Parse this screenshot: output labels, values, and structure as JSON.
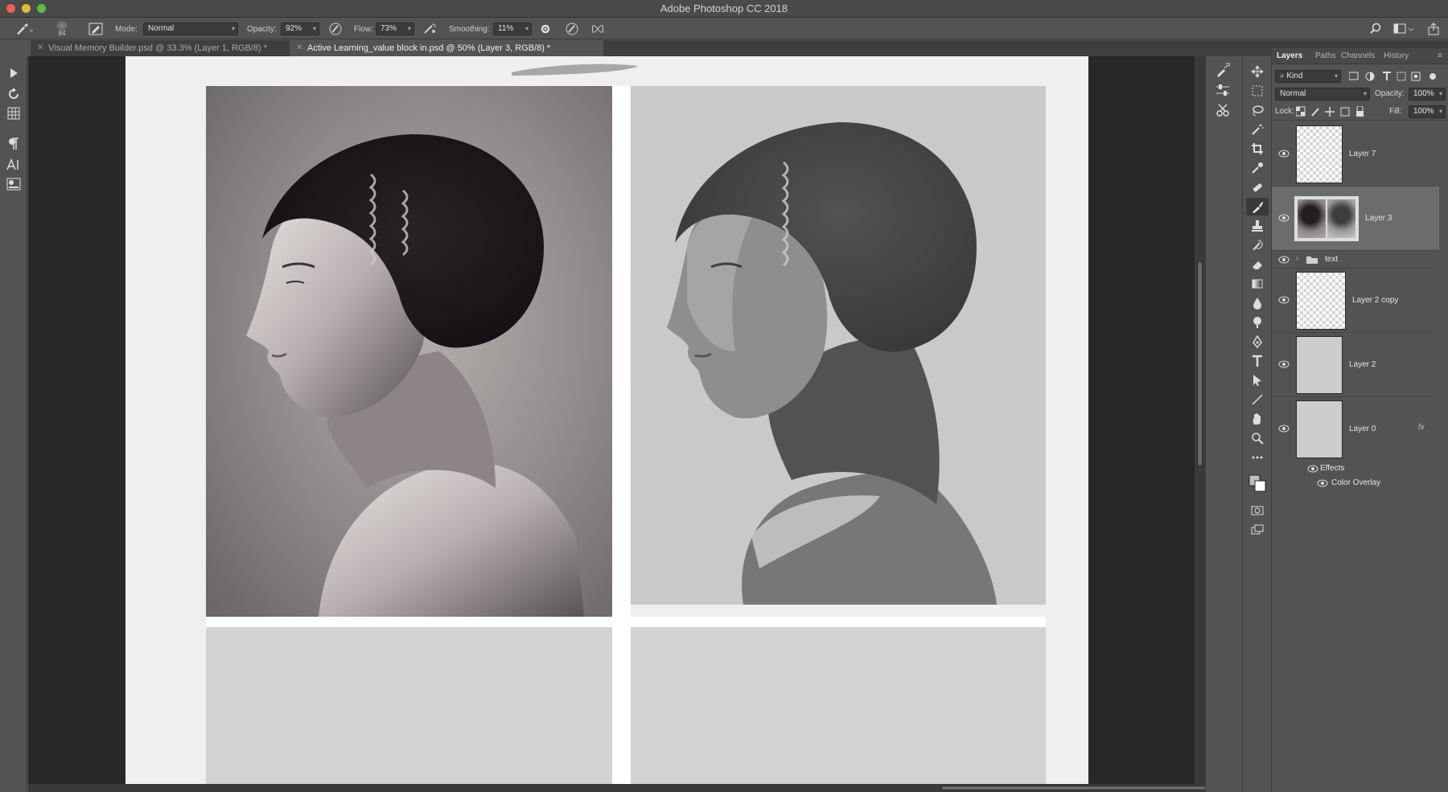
{
  "window": {
    "title": "Adobe Photoshop CC 2018"
  },
  "options_bar": {
    "brush_size": "84",
    "mode_label": "Mode:",
    "mode_value": "Normal",
    "opacity_label": "Opacity:",
    "opacity_value": "92%",
    "flow_label": "Flow:",
    "flow_value": "73%",
    "smoothing_label": "Smoothing:",
    "smoothing_value": "11%"
  },
  "tabs": [
    {
      "label": "Visual Memory Builder.psd @ 33.3% (Layer 1, RGB/8) *",
      "active": false
    },
    {
      "label": "Active Learning_value block in.psd @ 50% (Layer 3, RGB/8) *",
      "active": true
    }
  ],
  "panel": {
    "tabs": [
      "Layers",
      "Paths",
      "Channels",
      "History"
    ],
    "filter_value": "Kind",
    "blend_mode": "Normal",
    "opacity_label": "Opacity:",
    "opacity_value": "100%",
    "lock_label": "Lock:",
    "fill_label": "Fill:",
    "fill_value": "100%"
  },
  "layers": [
    {
      "name": "Layer 7",
      "visible": true,
      "selected": false,
      "kind": "transparent"
    },
    {
      "name": "Layer 3",
      "visible": true,
      "selected": true,
      "kind": "image"
    },
    {
      "name": "text",
      "visible": true,
      "selected": false,
      "kind": "group"
    },
    {
      "name": "Layer 2 copy",
      "visible": true,
      "selected": false,
      "kind": "transparent"
    },
    {
      "name": "Layer 2",
      "visible": true,
      "selected": false,
      "kind": "solid"
    },
    {
      "name": "Layer 0",
      "visible": true,
      "selected": false,
      "kind": "solid",
      "fx": "fx"
    }
  ],
  "effects": {
    "label": "Effects",
    "items": [
      "Color Overlay"
    ]
  },
  "colors": {
    "chrome": "#535353",
    "canvas_bg": "#282828",
    "doc_bg": "#efefef",
    "placeholder": "#d2d2d2",
    "selected_layer": "#6c6c6c"
  },
  "icons": {
    "left_tools": [
      "move-arrow-icon",
      "rotate-view-icon",
      "grid-icon",
      "paragraph-icon",
      "character-icon",
      "glyphs-icon"
    ],
    "dock1": [
      "brush-preset-icon",
      "adjust-icon",
      "clone-source-icon"
    ],
    "toolbox": [
      "move-tool-icon",
      "marquee-icon",
      "lasso-icon",
      "magic-wand-icon",
      "crop-icon",
      "eyedropper-icon",
      "healing-icon",
      "brush-icon",
      "stamp-icon",
      "history-brush-icon",
      "eraser-icon",
      "gradient-icon",
      "blur-icon",
      "dodge-icon",
      "pen-icon",
      "type-icon",
      "path-select-icon",
      "line-icon",
      "hand-icon",
      "zoom-icon",
      "more-icon"
    ]
  }
}
